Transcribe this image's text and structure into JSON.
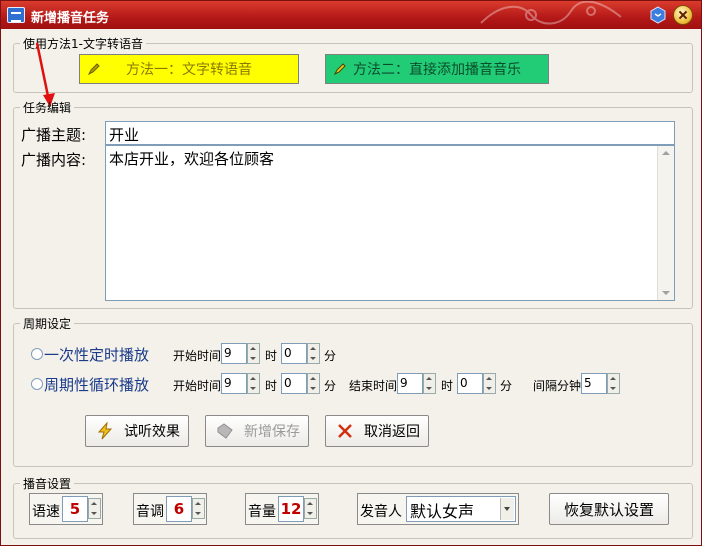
{
  "window": {
    "title": "新增播音任务"
  },
  "method_group": {
    "legend": "使用方法1-文字转语音",
    "method1_label": "方法一：文字转语音",
    "method2_label": "方法二：直接添加播音音乐"
  },
  "task_group": {
    "legend": "任务编辑",
    "topic_label": "广播主题:",
    "topic_value": "开业",
    "content_label": "广播内容:",
    "content_value": "本店开业，欢迎各位顾客"
  },
  "period_group": {
    "legend": "周期设定",
    "once_label": "一次性定时播放",
    "cycle_label": "周期性循环播放",
    "start_time_label": "开始时间",
    "end_time_label": "结束时间",
    "hour_unit": "时",
    "minute_unit": "分",
    "interval_label": "间隔分钟",
    "once_start_hour": "9",
    "once_start_minute": "0",
    "cycle_start_hour": "9",
    "cycle_start_minute": "0",
    "cycle_end_hour": "9",
    "cycle_end_minute": "0",
    "interval_value": "5"
  },
  "actions": {
    "preview_label": "试听效果",
    "save_label": "新增保存",
    "cancel_label": "取消返回"
  },
  "play_group": {
    "legend": "播音设置",
    "speed_label": "语速",
    "speed_value": "5",
    "pitch_label": "音调",
    "pitch_value": "6",
    "volume_label": "音量",
    "volume_value": "12",
    "speaker_label": "发音人",
    "speaker_value": "默认女声",
    "reset_label": "恢复默认设置"
  },
  "colors": {
    "title_bar": "#b41818",
    "method1_bg": "#ffff00",
    "method2_bg": "#22cc77",
    "value_red": "#c00000"
  }
}
